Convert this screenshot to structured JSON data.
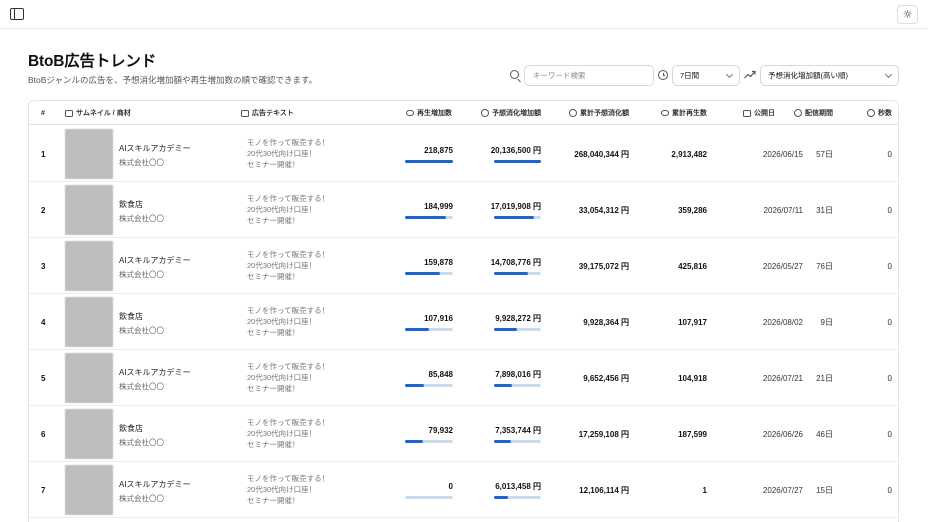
{
  "header": {
    "title": "BtoB広告トレンド",
    "subtitle": "BtoBジャンルの広告を、予想消化増加額や再生増加数の順で確認できます。"
  },
  "toolbar": {
    "search_placeholder": "キーワード検索",
    "period_value": "7日間",
    "sort_value": "予想消化増加額(高い順)",
    "theme_icon": "☼"
  },
  "columns": [
    "#",
    "サムネイル / 商材",
    "広告テキスト",
    "再生増加数",
    "予想消化増加額",
    "累計予想消化額",
    "累計再生数",
    "公開日",
    "配信期間",
    "秒数"
  ],
  "rows": [
    {
      "idx": "1",
      "name": "AIスキルアカデミー",
      "company": "株式会社〇〇",
      "text": "モノを作って販売する！\n20代30代向け口座！\nセミナー開催！",
      "views_inc": "218,875",
      "views_ratio": 1.0,
      "spend_inc": "20,136,500 円",
      "spend_ratio": 1.0,
      "total_spend": "268,040,344 円",
      "total_views": "2,913,482",
      "date": "2026/06/15",
      "period": "57日",
      "seconds": "0"
    },
    {
      "idx": "2",
      "name": "飲食店",
      "company": "株式会社〇〇",
      "text": "モノを作って販売する！\n20代30代向け口座！\nセミナー開催！",
      "views_inc": "184,999",
      "views_ratio": 0.845,
      "spend_inc": "17,019,908 円",
      "spend_ratio": 0.845,
      "total_spend": "33,054,312 円",
      "total_views": "359,286",
      "date": "2026/07/11",
      "period": "31日",
      "seconds": "0"
    },
    {
      "idx": "3",
      "name": "AIスキルアカデミー",
      "company": "株式会社〇〇",
      "text": "モノを作って販売する！\n20代30代向け口座！\nセミナー開催！",
      "views_inc": "159,878",
      "views_ratio": 0.73,
      "spend_inc": "14,708,776 円",
      "spend_ratio": 0.73,
      "total_spend": "39,175,072 円",
      "total_views": "425,816",
      "date": "2026/05/27",
      "period": "76日",
      "seconds": "0"
    },
    {
      "idx": "4",
      "name": "飲食店",
      "company": "株式会社〇〇",
      "text": "モノを作って販売する！\n20代30代向け口座！\nセミナー開催！",
      "views_inc": "107,916",
      "views_ratio": 0.493,
      "spend_inc": "9,928,272 円",
      "spend_ratio": 0.493,
      "total_spend": "9,928,364 円",
      "total_views": "107,917",
      "date": "2026/08/02",
      "period": "9日",
      "seconds": "0"
    },
    {
      "idx": "5",
      "name": "AIスキルアカデミー",
      "company": "株式会社〇〇",
      "text": "モノを作って販売する！\n20代30代向け口座！\nセミナー開催！",
      "views_inc": "85,848",
      "views_ratio": 0.392,
      "spend_inc": "7,898,016 円",
      "spend_ratio": 0.392,
      "total_spend": "9,652,456 円",
      "total_views": "104,918",
      "date": "2026/07/21",
      "period": "21日",
      "seconds": "0"
    },
    {
      "idx": "6",
      "name": "飲食店",
      "company": "株式会社〇〇",
      "text": "モノを作って販売する！\n20代30代向け口座！\nセミナー開催！",
      "views_inc": "79,932",
      "views_ratio": 0.365,
      "spend_inc": "7,353,744 円",
      "spend_ratio": 0.365,
      "total_spend": "17,259,108 円",
      "total_views": "187,599",
      "date": "2026/06/26",
      "period": "46日",
      "seconds": "0"
    },
    {
      "idx": "7",
      "name": "AIスキルアカデミー",
      "company": "株式会社〇〇",
      "text": "モノを作って販売する！\n20代30代向け口座！\nセミナー開催！",
      "views_inc": "0",
      "views_ratio": 0.0,
      "spend_inc": "6,013,458 円",
      "spend_ratio": 0.299,
      "total_spend": "12,106,114 円",
      "total_views": "1",
      "date": "2026/07/27",
      "period": "15日",
      "seconds": "0"
    }
  ],
  "colors": {
    "bar_fill": "#1a64d4",
    "bar_track": "#c8ddf3"
  }
}
